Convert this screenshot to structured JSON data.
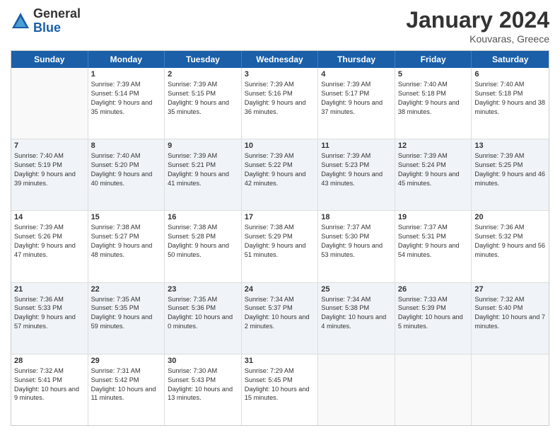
{
  "logo": {
    "general": "General",
    "blue": "Blue"
  },
  "title": {
    "month_year": "January 2024",
    "location": "Kouvaras, Greece"
  },
  "days_of_week": [
    "Sunday",
    "Monday",
    "Tuesday",
    "Wednesday",
    "Thursday",
    "Friday",
    "Saturday"
  ],
  "rows": [
    [
      {
        "day": "",
        "sunrise": "",
        "sunset": "",
        "daylight": "",
        "empty": true
      },
      {
        "day": "1",
        "sunrise": "Sunrise: 7:39 AM",
        "sunset": "Sunset: 5:14 PM",
        "daylight": "Daylight: 9 hours and 35 minutes."
      },
      {
        "day": "2",
        "sunrise": "Sunrise: 7:39 AM",
        "sunset": "Sunset: 5:15 PM",
        "daylight": "Daylight: 9 hours and 35 minutes."
      },
      {
        "day": "3",
        "sunrise": "Sunrise: 7:39 AM",
        "sunset": "Sunset: 5:16 PM",
        "daylight": "Daylight: 9 hours and 36 minutes."
      },
      {
        "day": "4",
        "sunrise": "Sunrise: 7:39 AM",
        "sunset": "Sunset: 5:17 PM",
        "daylight": "Daylight: 9 hours and 37 minutes."
      },
      {
        "day": "5",
        "sunrise": "Sunrise: 7:40 AM",
        "sunset": "Sunset: 5:18 PM",
        "daylight": "Daylight: 9 hours and 38 minutes."
      },
      {
        "day": "6",
        "sunrise": "Sunrise: 7:40 AM",
        "sunset": "Sunset: 5:18 PM",
        "daylight": "Daylight: 9 hours and 38 minutes."
      }
    ],
    [
      {
        "day": "7",
        "sunrise": "Sunrise: 7:40 AM",
        "sunset": "Sunset: 5:19 PM",
        "daylight": "Daylight: 9 hours and 39 minutes."
      },
      {
        "day": "8",
        "sunrise": "Sunrise: 7:40 AM",
        "sunset": "Sunset: 5:20 PM",
        "daylight": "Daylight: 9 hours and 40 minutes."
      },
      {
        "day": "9",
        "sunrise": "Sunrise: 7:39 AM",
        "sunset": "Sunset: 5:21 PM",
        "daylight": "Daylight: 9 hours and 41 minutes."
      },
      {
        "day": "10",
        "sunrise": "Sunrise: 7:39 AM",
        "sunset": "Sunset: 5:22 PM",
        "daylight": "Daylight: 9 hours and 42 minutes."
      },
      {
        "day": "11",
        "sunrise": "Sunrise: 7:39 AM",
        "sunset": "Sunset: 5:23 PM",
        "daylight": "Daylight: 9 hours and 43 minutes."
      },
      {
        "day": "12",
        "sunrise": "Sunrise: 7:39 AM",
        "sunset": "Sunset: 5:24 PM",
        "daylight": "Daylight: 9 hours and 45 minutes."
      },
      {
        "day": "13",
        "sunrise": "Sunrise: 7:39 AM",
        "sunset": "Sunset: 5:25 PM",
        "daylight": "Daylight: 9 hours and 46 minutes."
      }
    ],
    [
      {
        "day": "14",
        "sunrise": "Sunrise: 7:39 AM",
        "sunset": "Sunset: 5:26 PM",
        "daylight": "Daylight: 9 hours and 47 minutes."
      },
      {
        "day": "15",
        "sunrise": "Sunrise: 7:38 AM",
        "sunset": "Sunset: 5:27 PM",
        "daylight": "Daylight: 9 hours and 48 minutes."
      },
      {
        "day": "16",
        "sunrise": "Sunrise: 7:38 AM",
        "sunset": "Sunset: 5:28 PM",
        "daylight": "Daylight: 9 hours and 50 minutes."
      },
      {
        "day": "17",
        "sunrise": "Sunrise: 7:38 AM",
        "sunset": "Sunset: 5:29 PM",
        "daylight": "Daylight: 9 hours and 51 minutes."
      },
      {
        "day": "18",
        "sunrise": "Sunrise: 7:37 AM",
        "sunset": "Sunset: 5:30 PM",
        "daylight": "Daylight: 9 hours and 53 minutes."
      },
      {
        "day": "19",
        "sunrise": "Sunrise: 7:37 AM",
        "sunset": "Sunset: 5:31 PM",
        "daylight": "Daylight: 9 hours and 54 minutes."
      },
      {
        "day": "20",
        "sunrise": "Sunrise: 7:36 AM",
        "sunset": "Sunset: 5:32 PM",
        "daylight": "Daylight: 9 hours and 56 minutes."
      }
    ],
    [
      {
        "day": "21",
        "sunrise": "Sunrise: 7:36 AM",
        "sunset": "Sunset: 5:33 PM",
        "daylight": "Daylight: 9 hours and 57 minutes."
      },
      {
        "day": "22",
        "sunrise": "Sunrise: 7:35 AM",
        "sunset": "Sunset: 5:35 PM",
        "daylight": "Daylight: 9 hours and 59 minutes."
      },
      {
        "day": "23",
        "sunrise": "Sunrise: 7:35 AM",
        "sunset": "Sunset: 5:36 PM",
        "daylight": "Daylight: 10 hours and 0 minutes."
      },
      {
        "day": "24",
        "sunrise": "Sunrise: 7:34 AM",
        "sunset": "Sunset: 5:37 PM",
        "daylight": "Daylight: 10 hours and 2 minutes."
      },
      {
        "day": "25",
        "sunrise": "Sunrise: 7:34 AM",
        "sunset": "Sunset: 5:38 PM",
        "daylight": "Daylight: 10 hours and 4 minutes."
      },
      {
        "day": "26",
        "sunrise": "Sunrise: 7:33 AM",
        "sunset": "Sunset: 5:39 PM",
        "daylight": "Daylight: 10 hours and 5 minutes."
      },
      {
        "day": "27",
        "sunrise": "Sunrise: 7:32 AM",
        "sunset": "Sunset: 5:40 PM",
        "daylight": "Daylight: 10 hours and 7 minutes."
      }
    ],
    [
      {
        "day": "28",
        "sunrise": "Sunrise: 7:32 AM",
        "sunset": "Sunset: 5:41 PM",
        "daylight": "Daylight: 10 hours and 9 minutes."
      },
      {
        "day": "29",
        "sunrise": "Sunrise: 7:31 AM",
        "sunset": "Sunset: 5:42 PM",
        "daylight": "Daylight: 10 hours and 11 minutes."
      },
      {
        "day": "30",
        "sunrise": "Sunrise: 7:30 AM",
        "sunset": "Sunset: 5:43 PM",
        "daylight": "Daylight: 10 hours and 13 minutes."
      },
      {
        "day": "31",
        "sunrise": "Sunrise: 7:29 AM",
        "sunset": "Sunset: 5:45 PM",
        "daylight": "Daylight: 10 hours and 15 minutes."
      },
      {
        "day": "",
        "sunrise": "",
        "sunset": "",
        "daylight": "",
        "empty": true
      },
      {
        "day": "",
        "sunrise": "",
        "sunset": "",
        "daylight": "",
        "empty": true
      },
      {
        "day": "",
        "sunrise": "",
        "sunset": "",
        "daylight": "",
        "empty": true
      }
    ]
  ]
}
